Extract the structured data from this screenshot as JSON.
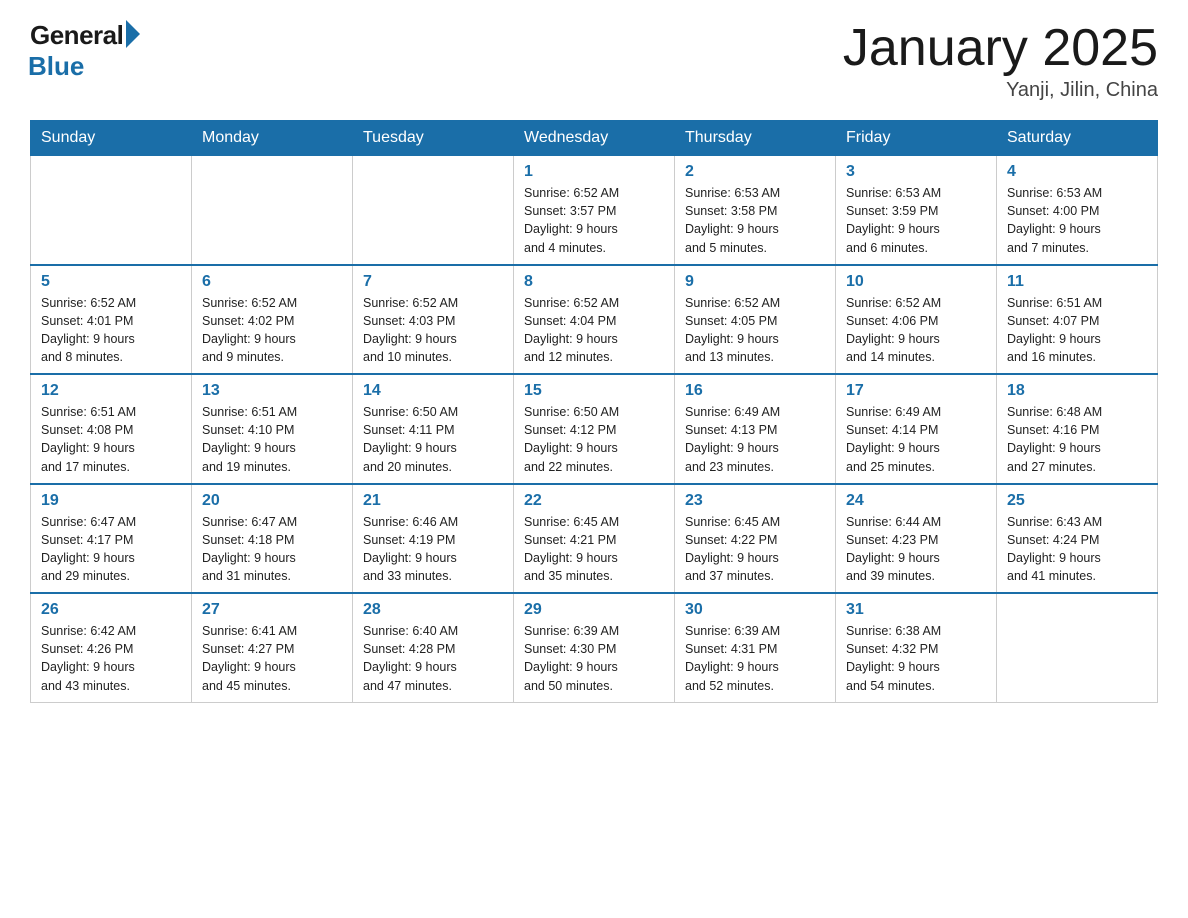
{
  "header": {
    "logo_general": "General",
    "logo_blue": "Blue",
    "title": "January 2025",
    "location": "Yanji, Jilin, China"
  },
  "days_of_week": [
    "Sunday",
    "Monday",
    "Tuesday",
    "Wednesday",
    "Thursday",
    "Friday",
    "Saturday"
  ],
  "weeks": [
    [
      {
        "day": "",
        "info": ""
      },
      {
        "day": "",
        "info": ""
      },
      {
        "day": "",
        "info": ""
      },
      {
        "day": "1",
        "info": "Sunrise: 6:52 AM\nSunset: 3:57 PM\nDaylight: 9 hours\nand 4 minutes."
      },
      {
        "day": "2",
        "info": "Sunrise: 6:53 AM\nSunset: 3:58 PM\nDaylight: 9 hours\nand 5 minutes."
      },
      {
        "day": "3",
        "info": "Sunrise: 6:53 AM\nSunset: 3:59 PM\nDaylight: 9 hours\nand 6 minutes."
      },
      {
        "day": "4",
        "info": "Sunrise: 6:53 AM\nSunset: 4:00 PM\nDaylight: 9 hours\nand 7 minutes."
      }
    ],
    [
      {
        "day": "5",
        "info": "Sunrise: 6:52 AM\nSunset: 4:01 PM\nDaylight: 9 hours\nand 8 minutes."
      },
      {
        "day": "6",
        "info": "Sunrise: 6:52 AM\nSunset: 4:02 PM\nDaylight: 9 hours\nand 9 minutes."
      },
      {
        "day": "7",
        "info": "Sunrise: 6:52 AM\nSunset: 4:03 PM\nDaylight: 9 hours\nand 10 minutes."
      },
      {
        "day": "8",
        "info": "Sunrise: 6:52 AM\nSunset: 4:04 PM\nDaylight: 9 hours\nand 12 minutes."
      },
      {
        "day": "9",
        "info": "Sunrise: 6:52 AM\nSunset: 4:05 PM\nDaylight: 9 hours\nand 13 minutes."
      },
      {
        "day": "10",
        "info": "Sunrise: 6:52 AM\nSunset: 4:06 PM\nDaylight: 9 hours\nand 14 minutes."
      },
      {
        "day": "11",
        "info": "Sunrise: 6:51 AM\nSunset: 4:07 PM\nDaylight: 9 hours\nand 16 minutes."
      }
    ],
    [
      {
        "day": "12",
        "info": "Sunrise: 6:51 AM\nSunset: 4:08 PM\nDaylight: 9 hours\nand 17 minutes."
      },
      {
        "day": "13",
        "info": "Sunrise: 6:51 AM\nSunset: 4:10 PM\nDaylight: 9 hours\nand 19 minutes."
      },
      {
        "day": "14",
        "info": "Sunrise: 6:50 AM\nSunset: 4:11 PM\nDaylight: 9 hours\nand 20 minutes."
      },
      {
        "day": "15",
        "info": "Sunrise: 6:50 AM\nSunset: 4:12 PM\nDaylight: 9 hours\nand 22 minutes."
      },
      {
        "day": "16",
        "info": "Sunrise: 6:49 AM\nSunset: 4:13 PM\nDaylight: 9 hours\nand 23 minutes."
      },
      {
        "day": "17",
        "info": "Sunrise: 6:49 AM\nSunset: 4:14 PM\nDaylight: 9 hours\nand 25 minutes."
      },
      {
        "day": "18",
        "info": "Sunrise: 6:48 AM\nSunset: 4:16 PM\nDaylight: 9 hours\nand 27 minutes."
      }
    ],
    [
      {
        "day": "19",
        "info": "Sunrise: 6:47 AM\nSunset: 4:17 PM\nDaylight: 9 hours\nand 29 minutes."
      },
      {
        "day": "20",
        "info": "Sunrise: 6:47 AM\nSunset: 4:18 PM\nDaylight: 9 hours\nand 31 minutes."
      },
      {
        "day": "21",
        "info": "Sunrise: 6:46 AM\nSunset: 4:19 PM\nDaylight: 9 hours\nand 33 minutes."
      },
      {
        "day": "22",
        "info": "Sunrise: 6:45 AM\nSunset: 4:21 PM\nDaylight: 9 hours\nand 35 minutes."
      },
      {
        "day": "23",
        "info": "Sunrise: 6:45 AM\nSunset: 4:22 PM\nDaylight: 9 hours\nand 37 minutes."
      },
      {
        "day": "24",
        "info": "Sunrise: 6:44 AM\nSunset: 4:23 PM\nDaylight: 9 hours\nand 39 minutes."
      },
      {
        "day": "25",
        "info": "Sunrise: 6:43 AM\nSunset: 4:24 PM\nDaylight: 9 hours\nand 41 minutes."
      }
    ],
    [
      {
        "day": "26",
        "info": "Sunrise: 6:42 AM\nSunset: 4:26 PM\nDaylight: 9 hours\nand 43 minutes."
      },
      {
        "day": "27",
        "info": "Sunrise: 6:41 AM\nSunset: 4:27 PM\nDaylight: 9 hours\nand 45 minutes."
      },
      {
        "day": "28",
        "info": "Sunrise: 6:40 AM\nSunset: 4:28 PM\nDaylight: 9 hours\nand 47 minutes."
      },
      {
        "day": "29",
        "info": "Sunrise: 6:39 AM\nSunset: 4:30 PM\nDaylight: 9 hours\nand 50 minutes."
      },
      {
        "day": "30",
        "info": "Sunrise: 6:39 AM\nSunset: 4:31 PM\nDaylight: 9 hours\nand 52 minutes."
      },
      {
        "day": "31",
        "info": "Sunrise: 6:38 AM\nSunset: 4:32 PM\nDaylight: 9 hours\nand 54 minutes."
      },
      {
        "day": "",
        "info": ""
      }
    ]
  ]
}
